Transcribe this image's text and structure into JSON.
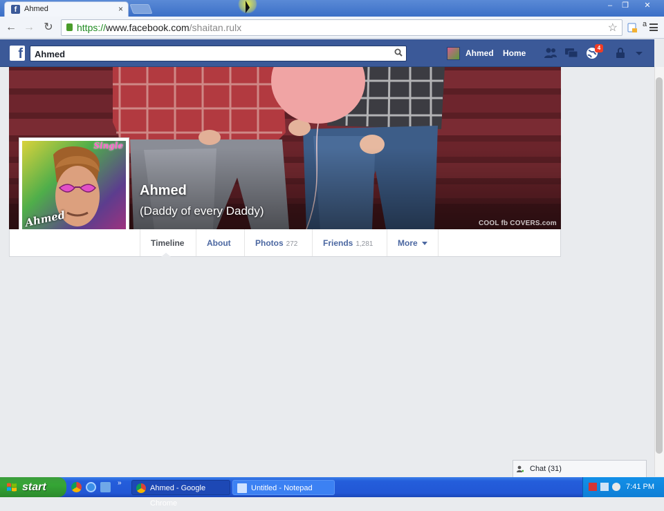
{
  "browser": {
    "tab_title": "Ahmed",
    "tab_close": "×",
    "url_scheme": "https://",
    "url_host": "www.facebook.com",
    "url_path": "/shaitan.rulx"
  },
  "fb": {
    "logo": "f",
    "search_value": "Ahmed",
    "user_name": "Ahmed",
    "home_label": "Home",
    "notification_count": "4"
  },
  "profile": {
    "name": "Ahmed",
    "subtitle": "(Daddy of every Daddy)",
    "cover_watermark": "COOL fb COVERS.com",
    "pic_text_single": "Single",
    "pic_text_signature": "Ahmed"
  },
  "nav": {
    "timeline": "Timeline",
    "about": "About",
    "photos": "Photos",
    "photos_count": "272",
    "friends": "Friends",
    "friends_count": "1,281",
    "more": "More"
  },
  "chat": {
    "label": "Chat (31)"
  },
  "taskbar": {
    "start": "start",
    "items": [
      {
        "label": "Ahmed - Google Chrome"
      },
      {
        "label": "Untitled - Notepad"
      }
    ],
    "clock": "7:41 PM"
  },
  "colors": {
    "fb_blue": "#3b5998",
    "link_blue": "#4b67a1",
    "page_bg": "#e9ebee",
    "badge_red": "#f03d25"
  }
}
